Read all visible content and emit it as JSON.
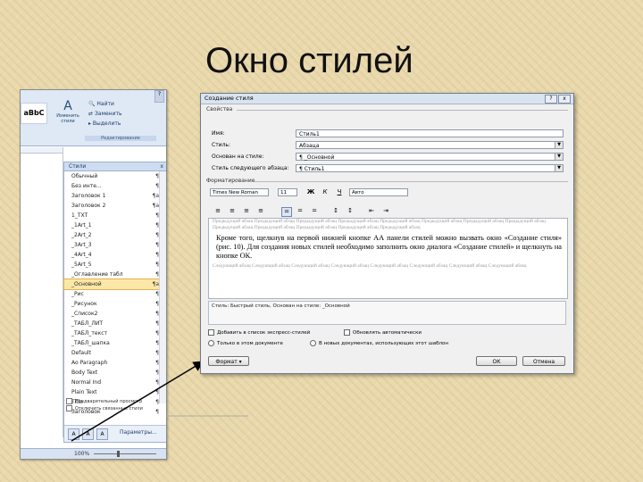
{
  "slide": {
    "title": "Окно стилей"
  },
  "word": {
    "styles_gallery": "aBbC",
    "change_styles": "Изменить стили",
    "edit_items": [
      "Найти",
      "Заменить",
      "Выделить"
    ],
    "edit_group": "Редактирование",
    "pane_title": "Стили",
    "pane_close": "x",
    "styles": [
      {
        "name": "Обычный",
        "mark": "¶"
      },
      {
        "name": "Без инте...",
        "mark": "¶"
      },
      {
        "name": "Заголовок 1",
        "mark": "¶a"
      },
      {
        "name": "Заголовок 2",
        "mark": "¶a"
      },
      {
        "name": "1_TXT",
        "mark": "¶"
      },
      {
        "name": "_1Art_1",
        "mark": "¶"
      },
      {
        "name": "_2Art_2",
        "mark": "¶"
      },
      {
        "name": "_3Art_3",
        "mark": "¶"
      },
      {
        "name": "_4Art_4",
        "mark": "¶"
      },
      {
        "name": "_5Art_5",
        "mark": "¶"
      },
      {
        "name": "_Оглавление табл",
        "mark": "¶"
      },
      {
        "name": "_Основной",
        "mark": "¶a",
        "selected": true
      },
      {
        "name": "_Рис",
        "mark": "¶"
      },
      {
        "name": "_Рисунок",
        "mark": "¶"
      },
      {
        "name": "_Список2",
        "mark": "¶"
      },
      {
        "name": "_ТАБЛ_ЛИТ",
        "mark": "¶"
      },
      {
        "name": "_ТАБЛ_текст",
        "mark": "¶"
      },
      {
        "name": "_ТАБЛ_шапка",
        "mark": "¶"
      },
      {
        "name": "Default",
        "mark": "¶"
      },
      {
        "name": "Ao Paragraph",
        "mark": "¶"
      },
      {
        "name": "Body Text",
        "mark": "¶"
      },
      {
        "name": "Normal Ind",
        "mark": "¶"
      },
      {
        "name": "Plain Text",
        "mark": "¶"
      },
      {
        "name": "Title",
        "mark": "¶"
      },
      {
        "name": "Заголовок",
        "mark": "¶"
      }
    ],
    "check_preview": "Предварительный просмотр",
    "check_linked": "Отключить связанные стили",
    "params": "Параметры...",
    "zoom": "100%"
  },
  "dialog": {
    "title": "Создание стиля",
    "help": "?",
    "close": "x",
    "props_title": "Свойства",
    "fields": [
      {
        "label": "Имя:",
        "value": "Стиль1"
      },
      {
        "label": "Стиль:",
        "value": "Абзаца"
      },
      {
        "label": "Основан на стиле:",
        "value": "¶ _Основной"
      },
      {
        "label": "Стиль следующего абзаца:",
        "value": "¶ Стиль1"
      }
    ],
    "format_title": "Форматирование",
    "font": "Times New Roman",
    "size": "11",
    "bold": "Ж",
    "italic": "К",
    "underline": "Ч",
    "color": "Авто",
    "prev_text": "Предыдущий абзац Предыдущий абзац Предыдущий абзац Предыдущий абзац Предыдущий абзац Предыдущий абзац Предыдущий абзац Предыдущий абзац Предыдущий абзац Предыдущий абзац Предыдущий абзац Предыдущий абзац Предыдущий абзац",
    "sample_text": "Кроме того, щелкнув на первой нижней кнопке АА панели стилей можно вызвать окно «Создание стиля» (рис. 10). Для создания новых стилей необходимо заполнить окно диалога «Создание стилей» и щелкнуть на кнопке ОК.",
    "next_text": "Следующий абзац Следующий абзац Следующий абзац Следующий абзац Следующий абзац Следующий абзац Следующий абзац Следующий абзац",
    "description": "Стиль: Быстрый стиль, Основан на стиле: _Основной",
    "add_quick": "Добавить в список экспресс-стилей",
    "auto_update": "Обновлять автоматически",
    "only_doc": "Только в этом документе",
    "new_docs": "В новых документах, использующих этот шаблон",
    "format_btn": "Формат ▾",
    "ok": "ОК",
    "cancel": "Отмена"
  }
}
